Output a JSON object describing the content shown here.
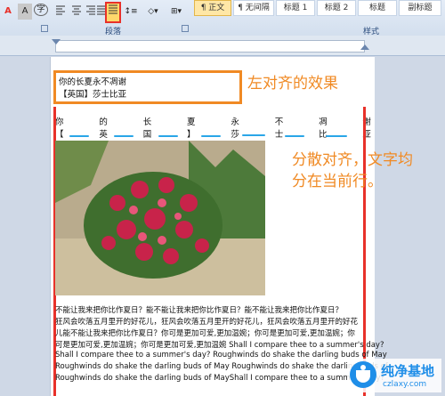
{
  "ribbon": {
    "font_color_label": "A",
    "char_shading_label": "A",
    "enclose_char_label": "字",
    "paragraph_group_label": "段落",
    "styles_group_label": "样式",
    "styles": [
      "¶ 正文",
      "¶ 无间隔",
      "标题 1",
      "标题 2",
      "标题",
      "副标题"
    ],
    "highlight_color": "#e8312a"
  },
  "document": {
    "left_lines": [
      "你的长夏永不凋谢",
      "【英国】莎士比亚"
    ],
    "distributed_chars_1": [
      "你",
      "的",
      "长",
      "夏",
      "永",
      "不",
      "凋",
      "谢"
    ],
    "distributed_chars_2": [
      "【",
      "英",
      "国",
      "】",
      "莎",
      "士",
      "比",
      "亚"
    ],
    "paragraph_lines": [
      "不能让我来把你比作夏日？能不能让我来把你比作夏日？能不能让我来把你比作夏日？",
      "狂风会吹落五月里开的好花儿，狂风会吹落五月里开的好花儿，狂风会吹落五月里开的好花",
      "儿能不能让我来把你比作夏日？你可是更加可爱,更加温婉；你可是更加可爱,更加温婉；你",
      "可是更加可爱,更加温婉；你可是更加可爱,更加温婉 Shall I compare thee to a summer's day?",
      "Shall I compare thee to a summer's day? Roughwinds do shake the darling buds of May",
      "Roughwinds do shake the darling buds of May Roughwinds do shake the darling buds of",
      "Roughwinds do shake the darling buds of MayShall I compare thee to a summer's day?"
    ]
  },
  "annotations": {
    "left_align": "左对齐的效果",
    "distributed_line1": "分散对齐，文字均",
    "distributed_line2": "分在当前行。",
    "accent_color": "#f08a24"
  },
  "logo": {
    "name": "纯净基地",
    "url": "czlaxy.com",
    "color": "#1f8ee8"
  }
}
